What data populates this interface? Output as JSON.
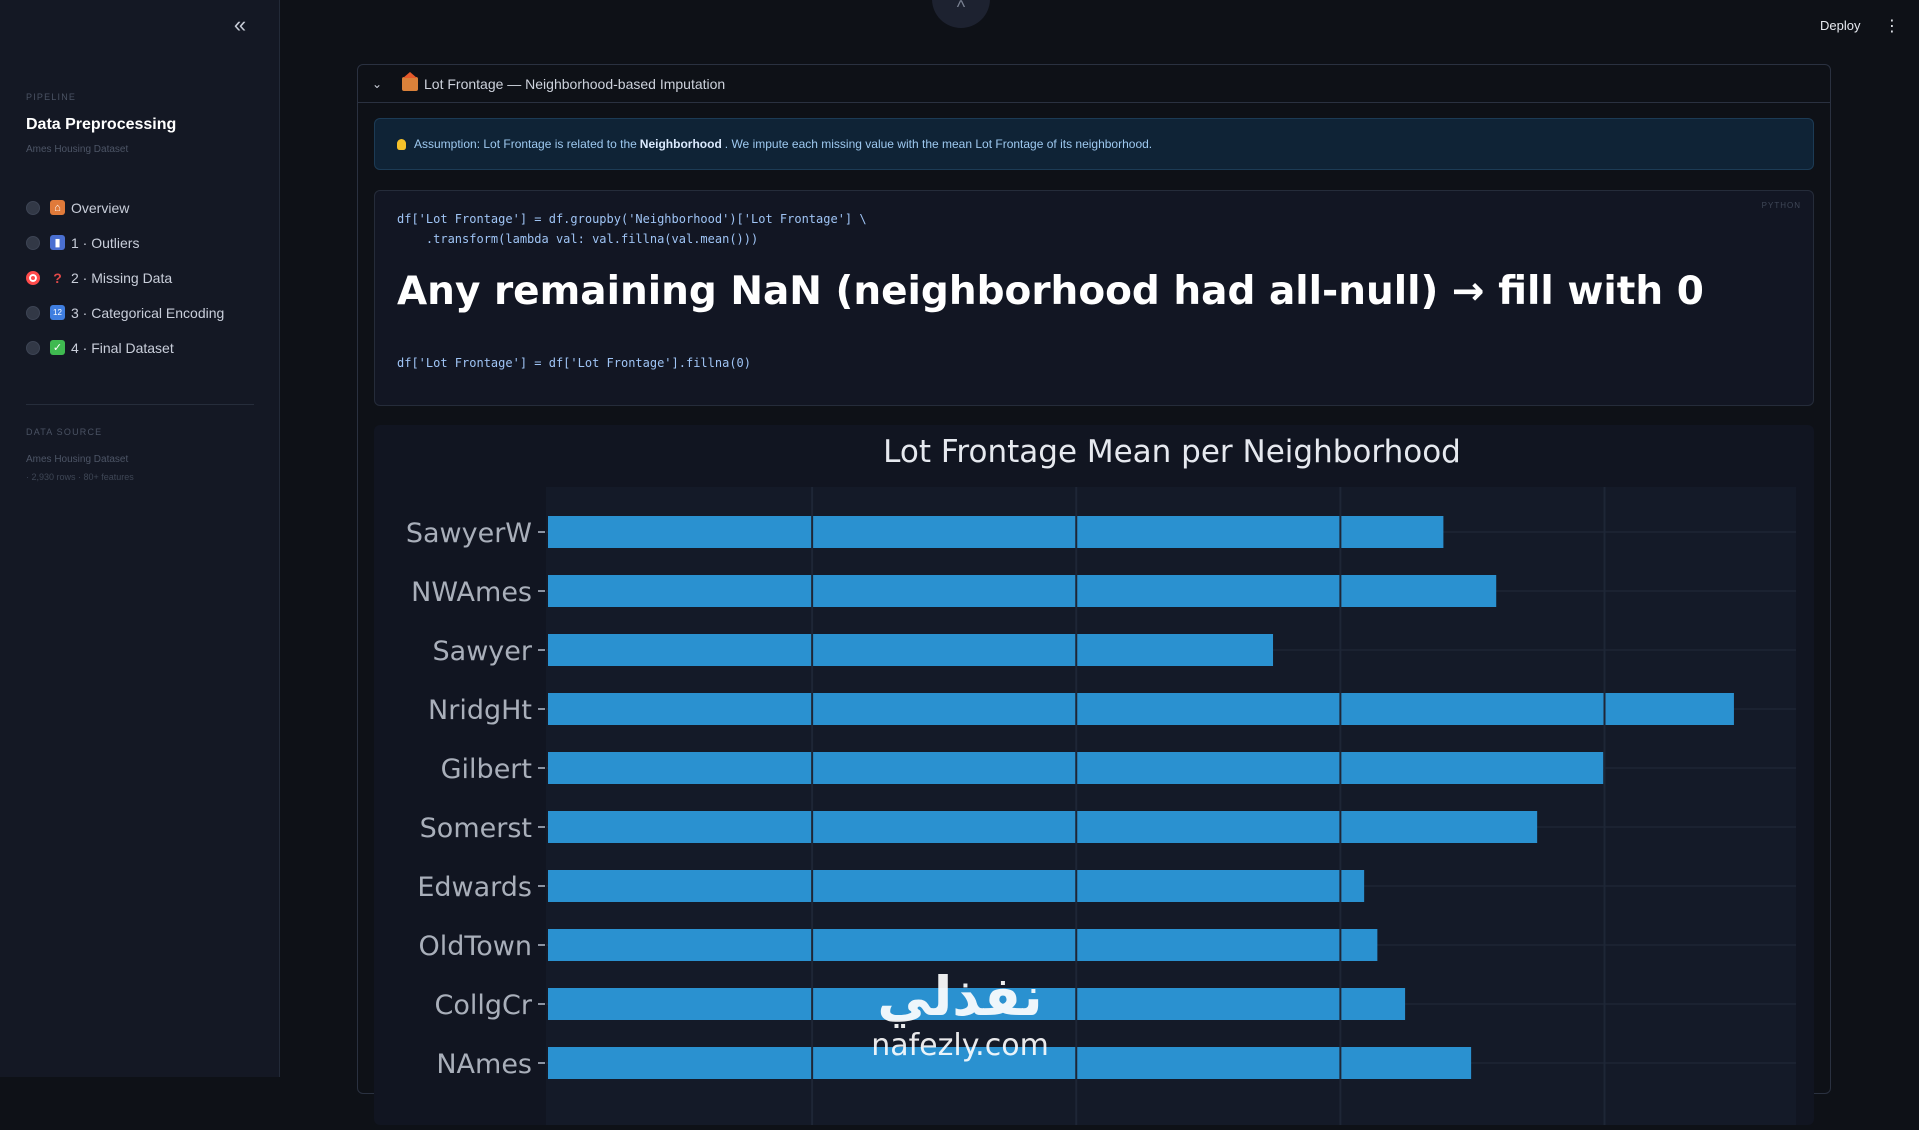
{
  "sidebar": {
    "collapse_icon": "«",
    "pipeline_label": "PIPELINE",
    "title": "Data Preprocessing",
    "subtitle": "Ames Housing Dataset",
    "items": [
      {
        "label": "Overview",
        "icon": "house-icon",
        "icon_color": "#e07a3a",
        "active": false
      },
      {
        "label": "1 · Outliers",
        "icon": "bar-chart-icon",
        "icon_color": "#4a6fd1",
        "active": false
      },
      {
        "label": "2 · Missing Data",
        "icon": "question-icon",
        "icon_color": "#e04848",
        "active": true
      },
      {
        "label": "3 · Categorical Encoding",
        "icon": "numbers-icon",
        "icon_color": "#3f7ee0",
        "active": false
      },
      {
        "label": "4 · Final Dataset",
        "icon": "checkmark-icon",
        "icon_color": "#3fb950",
        "active": false
      }
    ],
    "data_source_label": "DATA SOURCE",
    "data_source_name": "Ames Housing Dataset",
    "data_source_meta": "· 2,930 rows · 80+ features"
  },
  "header": {
    "top_icon": "^",
    "deploy_label": "Deploy",
    "menu_icon": "⋮"
  },
  "expander": {
    "chevron": "⌄",
    "title": "Lot Frontage — Neighborhood-based Imputation",
    "info_prefix": "Assumption: Lot Frontage is related to the",
    "info_bold": "Neighborhood",
    "info_suffix": ". We impute each missing value with the mean Lot Frontage of its neighborhood.",
    "code_lang": "PYTHON",
    "code_line1": "df['Lot Frontage'] = df.groupby('Neighborhood')['Lot Frontage'] \\",
    "code_line2": "    .transform(lambda val: val.fillna(val.mean()))",
    "code_heading": "Any remaining NaN (neighborhood had all-null) → fill with 0",
    "code_line3": "df['Lot Frontage'] = df['Lot Frontage'].fillna(0)"
  },
  "chart_data": {
    "type": "bar",
    "orientation": "horizontal",
    "title": "Lot Frontage Mean per Neighborhood",
    "categories": [
      "SawyerW",
      "NWAmes",
      "Sawyer",
      "NridgHt",
      "Gilbert",
      "Somerst",
      "Edwards",
      "OldTown",
      "CollgCr",
      "NAmes"
    ],
    "values": [
      67.8,
      71.8,
      54.9,
      89.8,
      79.9,
      74.9,
      61.8,
      62.8,
      64.9,
      69.9
    ],
    "xlim": [
      0,
      94.5
    ],
    "grid_values": [
      20,
      40,
      60,
      80
    ],
    "bar_color": "#2a91d0",
    "grid": true
  },
  "watermark": {
    "logo_text": "نفذلي",
    "url": "nafezly.com"
  }
}
